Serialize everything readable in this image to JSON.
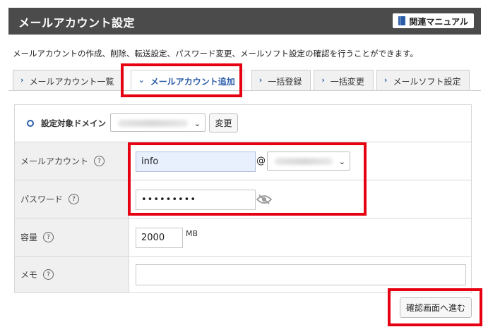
{
  "header": {
    "title": "メールアカウント設定",
    "manual_button": "関連マニュアル"
  },
  "description": "メールアカウントの作成、削除、転送設定、パスワード変更、メールソフト設定の確認を行うことができます。",
  "tabs": [
    {
      "label": "メールアカウント一覧",
      "active": false
    },
    {
      "label": "メールアカウント追加",
      "active": true
    },
    {
      "label": "一括登録",
      "active": false
    },
    {
      "label": "一括変更",
      "active": false
    },
    {
      "label": "メールソフト設定",
      "active": false
    }
  ],
  "form": {
    "domain": {
      "label": "設定対象ドメイン",
      "change_button": "変更"
    },
    "account": {
      "label": "メールアカウント",
      "value": "info",
      "at": "@"
    },
    "password": {
      "label": "パスワード",
      "masked_value": "•••••••••"
    },
    "capacity": {
      "label": "容量",
      "value": "2000",
      "unit": "MB"
    },
    "memo": {
      "label": "メモ",
      "value": ""
    },
    "help_symbol": "?"
  },
  "confirm_button": "確認画面へ進む",
  "colors": {
    "header_bg": "#4b4b4b",
    "accent": "#2a5ca8",
    "highlight": "#e60012"
  },
  "icons": {
    "tab_chevron": "›",
    "active_tab_chevron": "⌄",
    "caret": "⌄"
  }
}
